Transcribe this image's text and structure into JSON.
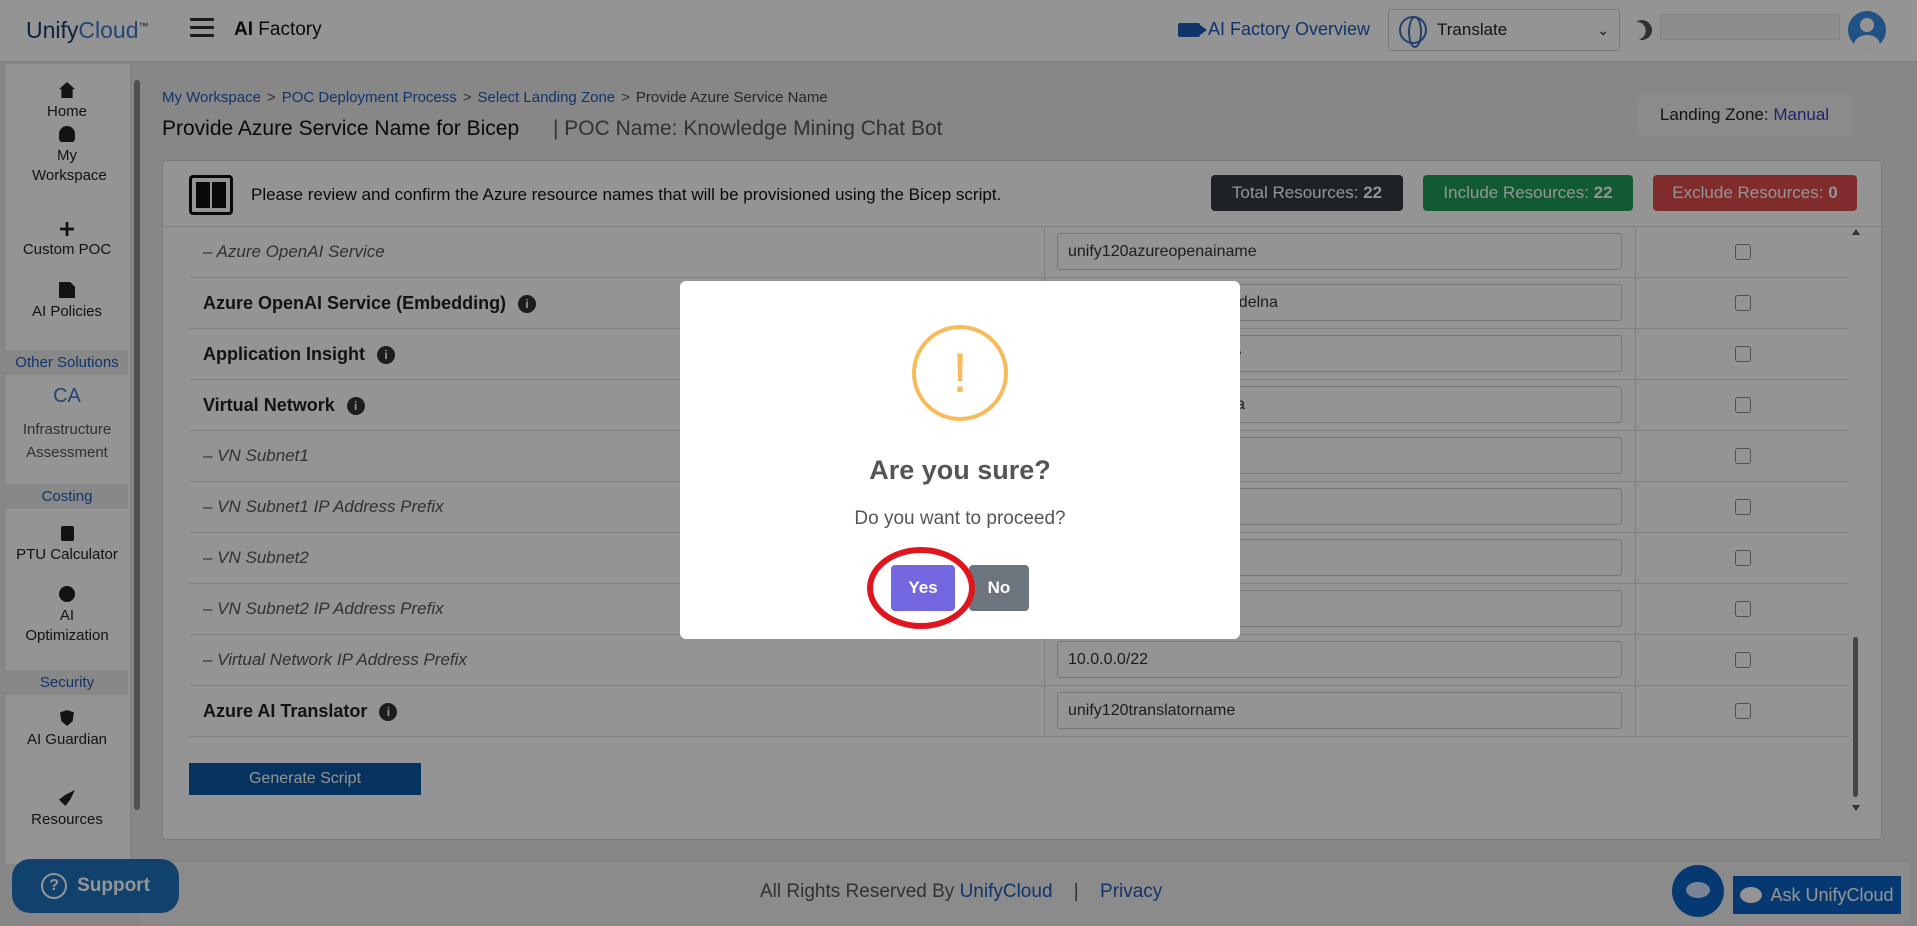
{
  "header": {
    "logo_main": "Unify",
    "logo_accent": "Cloud",
    "logo_tm": "™",
    "app_title_bold": "AI",
    "app_title_rest": " Factory",
    "overview_link": "AI Factory Overview",
    "translate_label": "Translate",
    "icons": [
      "menu-icon",
      "video-camera-icon",
      "globe-icon",
      "chevron-down-icon",
      "moon-icon",
      "user-avatar"
    ]
  },
  "sidebar": {
    "items": [
      {
        "label": "Home",
        "icon": "home-icon"
      },
      {
        "label": "My Workspace",
        "icon": "user-icon"
      },
      {
        "label": "Custom POC",
        "icon": "plus-icon"
      },
      {
        "label": "AI Policies",
        "icon": "policy-icon"
      }
    ],
    "section_other": "Other Solutions",
    "infra_icon_text": "CA",
    "infra_label": "Infrastructure Assessment",
    "section_costing": "Costing",
    "ptu_label": "PTU Calculator",
    "optimization_label": "AI Optimization",
    "section_security": "Security",
    "guardian_label": "AI Guardian",
    "resources_label": "Resources"
  },
  "breadcrumb": {
    "items": [
      "My Workspace",
      "POC Deployment Process",
      "Select Landing Zone"
    ],
    "separator": ">",
    "current": "Provide Azure Service Name"
  },
  "page": {
    "title": "Provide Azure Service Name for Bicep",
    "poc_name": "| POC Name: Knowledge Mining Chat Bot",
    "landing_zone_label": "Landing Zone:",
    "landing_zone_value": "Manual"
  },
  "card": {
    "message": "Please review and confirm the Azure resource names that will be provisioned using the Bicep script.",
    "total_label": "Total Resources:",
    "total_value": "22",
    "include_label": "Include Resources:",
    "include_value": "22",
    "exclude_label": "Exclude Resources:",
    "exclude_value": "0"
  },
  "rows": [
    {
      "name": "– Azure OpenAI Service",
      "value": "unify120azureopenainame",
      "style": "sub"
    },
    {
      "name": "Azure OpenAI Service (Embedding)",
      "value": "unify120azureopenaimodelna",
      "style": "bold"
    },
    {
      "name": "Application Insight",
      "value": "unify120appinsightname",
      "style": "bold"
    },
    {
      "name": "Virtual Network",
      "value": "unify120virtualnetworkna",
      "style": "bold"
    },
    {
      "name": "– VN Subnet1",
      "value": "",
      "style": "sub"
    },
    {
      "name": "– VN Subnet1 IP Address Prefix",
      "value": "",
      "style": "sub"
    },
    {
      "name": "– VN Subnet2",
      "value": "",
      "style": "sub"
    },
    {
      "name": "– VN Subnet2 IP Address Prefix",
      "value": "",
      "style": "sub"
    },
    {
      "name": "– Virtual Network IP Address Prefix",
      "value": "10.0.0.0/22",
      "style": "sub"
    },
    {
      "name": "Azure AI Translator",
      "value": "unify120translatorname",
      "style": "bold"
    }
  ],
  "generate_button": "Generate Script",
  "footer": {
    "rights": "All Rights Reserved By",
    "brand": "UnifyCloud",
    "pipe": "|",
    "privacy": "Privacy",
    "support": "Support",
    "ask": "Ask UnifyCloud"
  },
  "modal": {
    "icon_glyph": "!",
    "title": "Are you sure?",
    "text": "Do you want to proceed?",
    "yes": "Yes",
    "no": "No"
  }
}
